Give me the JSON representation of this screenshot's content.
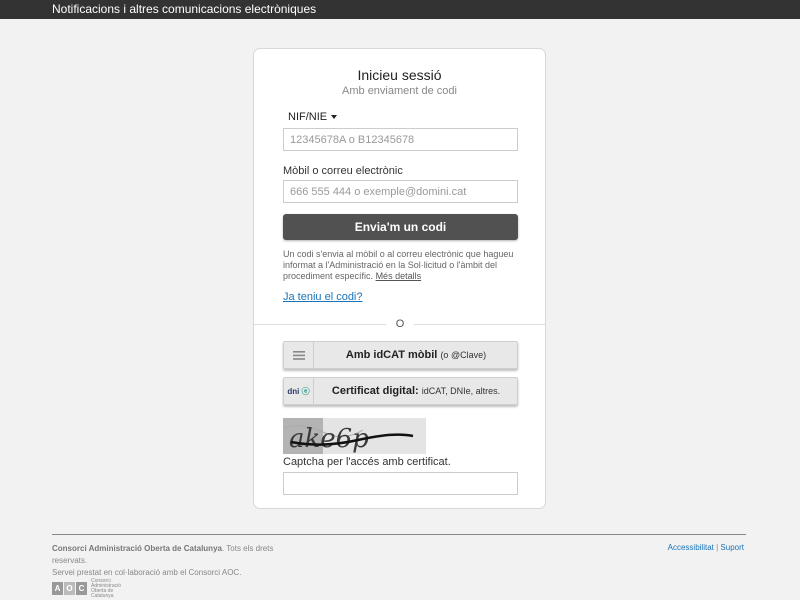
{
  "header": {
    "title": "Notificacions i altres comunicacions electròniques"
  },
  "login": {
    "title": "Inicieu sessió",
    "subtitle": "Amb enviament de codi",
    "id_type_selected": "NIF/NIE",
    "nif_placeholder": "12345678A o B12345678",
    "contact_label": "Mòbil o correu electrònic",
    "contact_placeholder": "666 555 444 o exemple@domini.cat",
    "send_button": "Envia'm un codi",
    "info_text": "Un codi s'envia al mòbil o al correu electrònic que hagueu informat a l'Administració en la Sol·licitud o l'àmbit del procediment específic.",
    "info_link": "Més detalls",
    "have_code_link": "Ja teniu el codi?",
    "divider_text": "O"
  },
  "methods": {
    "idcat_label": "Amb idCAT mòbil",
    "idcat_note": "(o @Clave)",
    "cert_label": "Certificat digital:",
    "cert_note": "idCAT, DNIe, altres.",
    "cert_icon_text": "dni"
  },
  "captcha": {
    "text": "ake6p",
    "label": "Captcha per l'accés amb certificat."
  },
  "footer": {
    "org_name": "Consorci Administració Oberta de Catalunya",
    "rights": ". Tots els drets reservats.",
    "service_text": "Servei prestat en col·laboració amb el Consorci AOC.",
    "accessibility_link": "Accessibilitat",
    "separator": "|",
    "support_link": "Suport",
    "logo_letters": [
      "A",
      "O",
      "C"
    ],
    "logo_text": "Consorci Administració Oberta de Catalunya"
  },
  "colors": {
    "topbar": "#333333",
    "primary_button": "#515151",
    "link": "#1a73b8",
    "background": "#f2f2f2"
  },
  "icons": {
    "idcat": "menu-lines-icon",
    "cert": "dni-icon",
    "select": "caret-down-icon"
  }
}
